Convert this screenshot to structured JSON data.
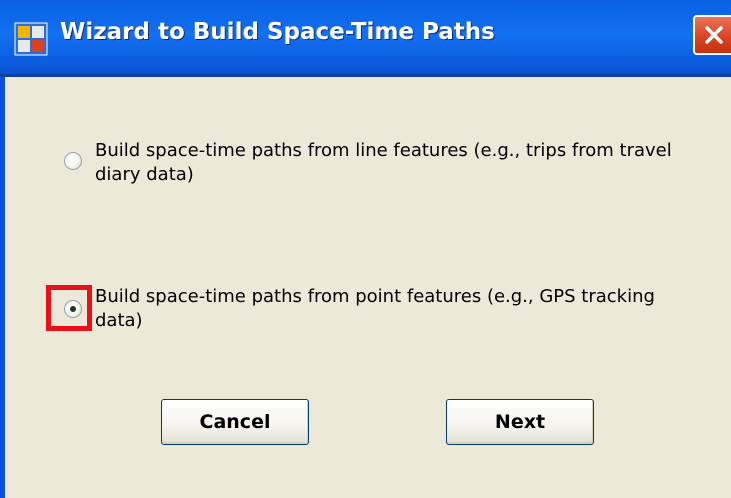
{
  "window": {
    "title": "Wizard to Build Space-Time Paths",
    "icon": "app-window-icon",
    "close_icon": "close-icon"
  },
  "options": [
    {
      "label": "Build space-time paths from line features (e.g., trips from travel diary data)",
      "selected": false
    },
    {
      "label": "Build space-time paths from point features (e.g., GPS tracking data)",
      "selected": true
    }
  ],
  "buttons": {
    "cancel": "Cancel",
    "next": "Next"
  },
  "colors": {
    "titlebar": "#0B63E6",
    "client_bg": "#ECE9D8",
    "highlight": "#E8101A",
    "close": "#D9411E"
  }
}
